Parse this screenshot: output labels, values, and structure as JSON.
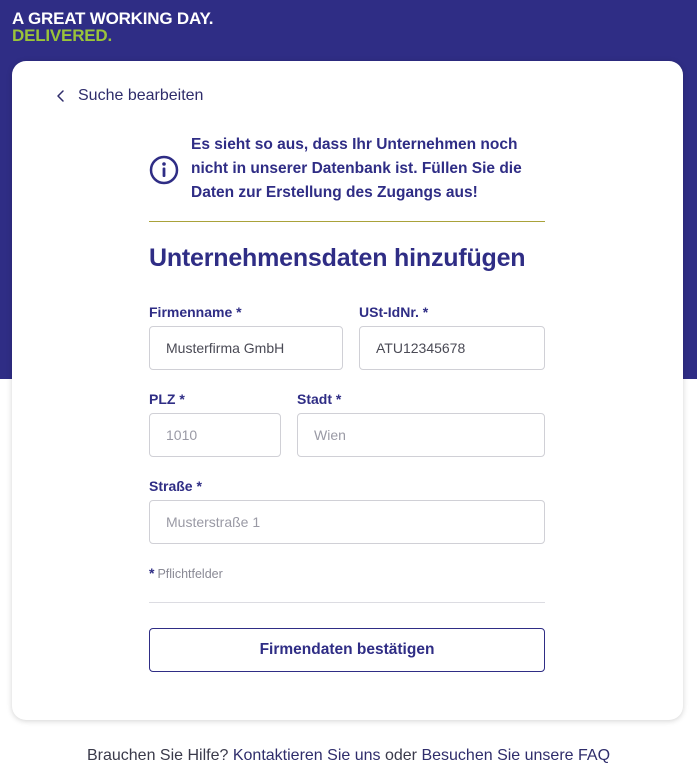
{
  "brand": {
    "line1": "A GREAT WORKING DAY.",
    "line2": "DELIVERED.",
    "primary_color": "#2f2d85",
    "accent_color": "#9ac43a"
  },
  "nav": {
    "back_label": "Suche bearbeiten",
    "back_icon": "chevron-left-icon"
  },
  "notice": {
    "icon": "info-icon",
    "text": "Es sieht so aus, dass Ihr Unternehmen noch nicht in unserer Datenbank ist. Füllen Sie die Daten zur Erstellung des Zugangs aus!"
  },
  "form": {
    "title": "Unternehmensdaten hinzufügen",
    "company": {
      "label": "Firmenname *",
      "value": "Musterfirma GmbH"
    },
    "vat": {
      "label": "USt-IdNr. *",
      "value": "ATU12345678"
    },
    "zip": {
      "label": "PLZ *",
      "placeholder": "1010"
    },
    "city": {
      "label": "Stadt *",
      "placeholder": "Wien"
    },
    "street": {
      "label": "Straße *",
      "placeholder": "Musterstraße 1"
    },
    "required_star": "*",
    "required_note": "Pflichtfelder",
    "submit_label": "Firmendaten bestätigen"
  },
  "footer": {
    "prefix": "Brauchen Sie Hilfe?",
    "contact_link": "Kontaktieren Sie uns",
    "or": "oder",
    "faq_link": "Besuchen Sie unsere FAQ"
  }
}
